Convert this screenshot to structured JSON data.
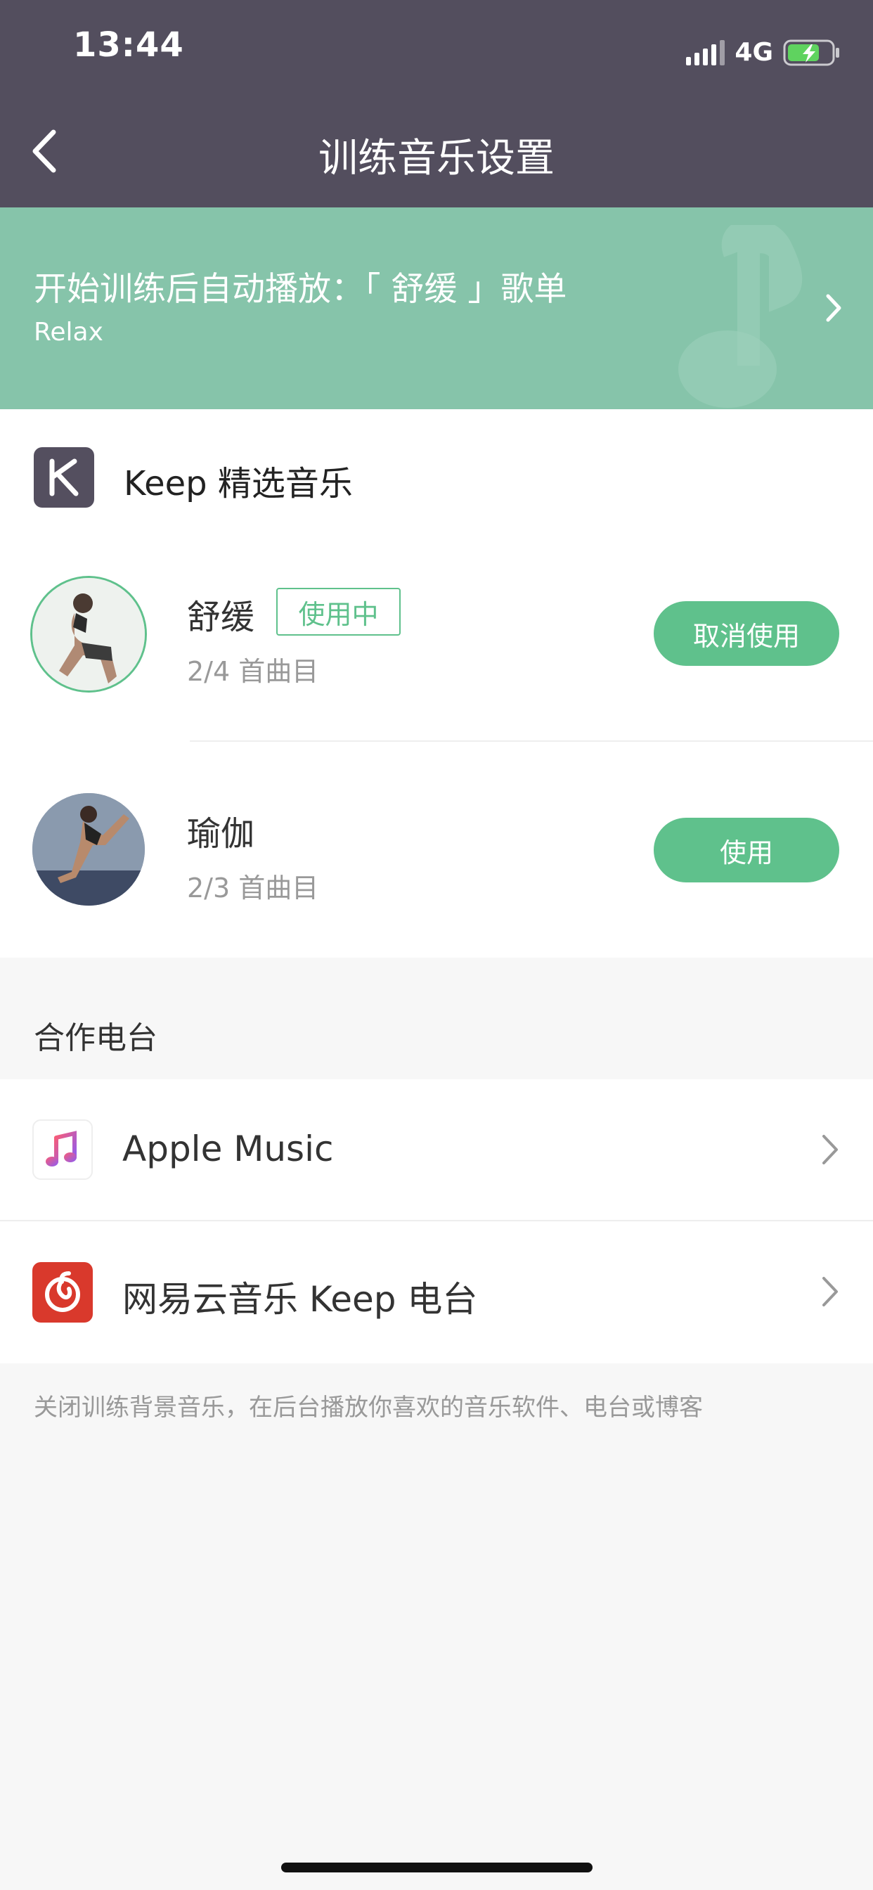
{
  "status_bar": {
    "time": "13:44",
    "network": "4G"
  },
  "nav": {
    "title": "训练音乐设置"
  },
  "banner": {
    "title": "开始训练后自动播放：「 舒缓 」歌单",
    "subtitle": "Relax"
  },
  "keep_section": {
    "title": "Keep 精选音乐",
    "playlists": [
      {
        "name": "舒缓",
        "badge": "使用中",
        "count": "2/4 首曲目",
        "action": "取消使用"
      },
      {
        "name": "瑜伽",
        "count": "2/3 首曲目",
        "action": "使用"
      }
    ]
  },
  "partners": {
    "header": "合作电台",
    "items": [
      {
        "label": "Apple Music"
      },
      {
        "label": "网易云音乐 Keep 电台"
      }
    ]
  },
  "footer": {
    "note": "关闭训练背景音乐，在后台播放你喜欢的音乐软件、电台或博客"
  },
  "colors": {
    "header_bg": "#534e5e",
    "banner_bg": "#86c4aa",
    "accent_green": "#5fc18c",
    "netease_red": "#d9392c"
  }
}
